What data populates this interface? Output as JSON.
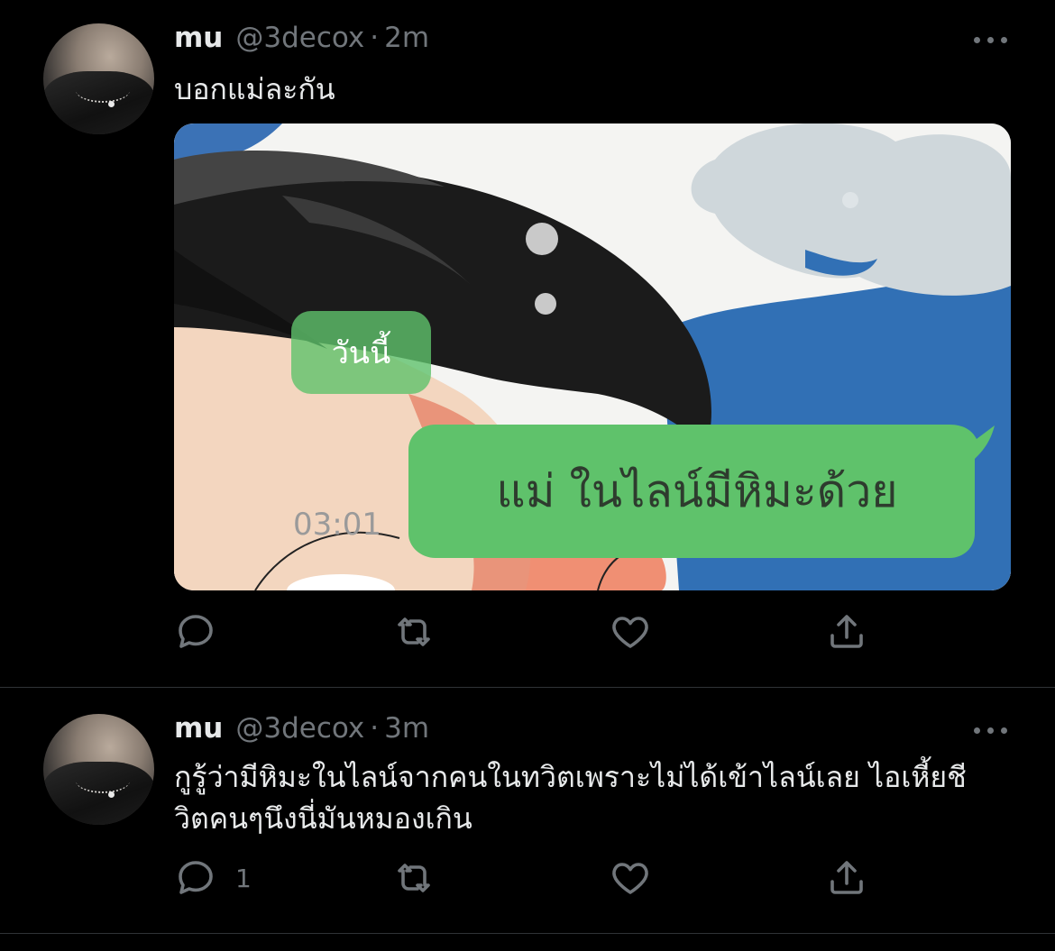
{
  "tweets": [
    {
      "name": "mu",
      "handle": "@3decox",
      "dot": "·",
      "time": "2m",
      "text_lines": [
        "บอกแม่ละกัน"
      ],
      "media": {
        "bubble_small": "วันนี้",
        "bubble_large": "แม่ ในไลน์มีหิมะด้วย",
        "timestamp": "03:01"
      },
      "actions": {
        "reply_count": "",
        "retweet_count": "",
        "like_count": ""
      }
    },
    {
      "name": "mu",
      "handle": "@3decox",
      "dot": "·",
      "time": "3m",
      "text_lines": [
        "กูรู้ว่ามีหิมะในไลน์จากคนในทวิตเพราะไม่ได้เข้าไลน์เลย ไอเหี้ยชี",
        "วิตคนๆนึงนี่มันหมองเกิน"
      ],
      "actions": {
        "reply_count": "1",
        "retweet_count": "",
        "like_count": ""
      }
    }
  ],
  "icons": [
    "reply-icon",
    "retweet-icon",
    "like-icon",
    "share-icon",
    "more-icon"
  ],
  "colors": {
    "background": "#000000",
    "text": "#e7e9ea",
    "secondary": "#71767b",
    "bubble_green": "#5fc26b"
  }
}
